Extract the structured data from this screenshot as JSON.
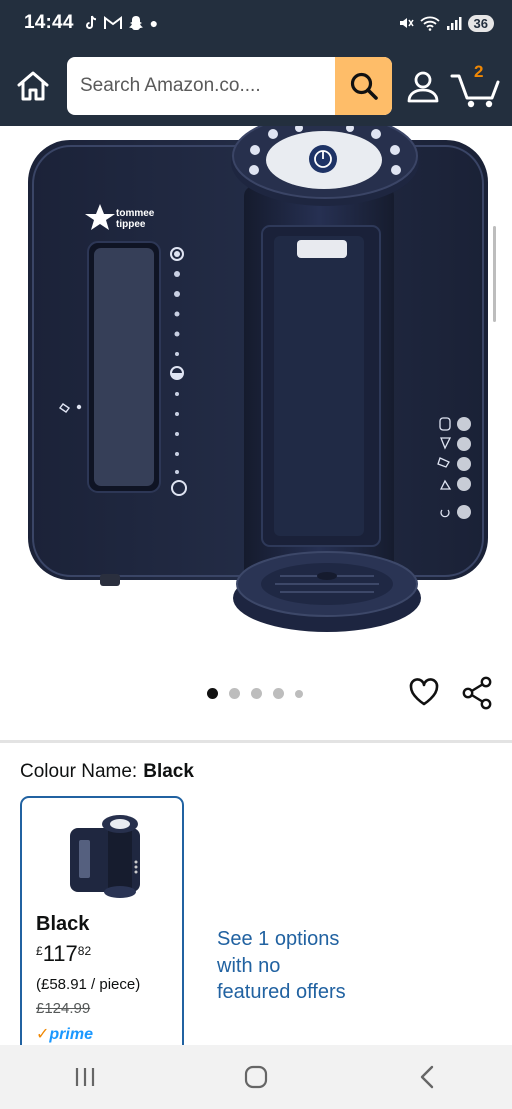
{
  "status_bar": {
    "time": "14:44",
    "battery": "36",
    "icons": [
      "tiktok-icon",
      "gmail-icon",
      "snapchat-icon",
      "dot-icon",
      "mute-icon",
      "wifi-icon",
      "signal-icon"
    ]
  },
  "header": {
    "search_placeholder": "Search Amazon.co....",
    "cart_count": "2"
  },
  "gallery": {
    "image_count": 5,
    "active_index": 0
  },
  "variation": {
    "label": "Colour Name:",
    "selected": "Black"
  },
  "swatch": {
    "name": "Black",
    "price_symbol": "£",
    "price_whole": "117",
    "price_fraction": "82",
    "unit_price": "(£58.91 / piece)",
    "was_price": "£124.99",
    "prime": "prime"
  },
  "offers_link": "See 1 options with no featured offers",
  "colors": {
    "header_bg": "#232f3e",
    "search_button": "#febd69",
    "link_blue": "#2162a1",
    "cart_count": "#f08804"
  }
}
